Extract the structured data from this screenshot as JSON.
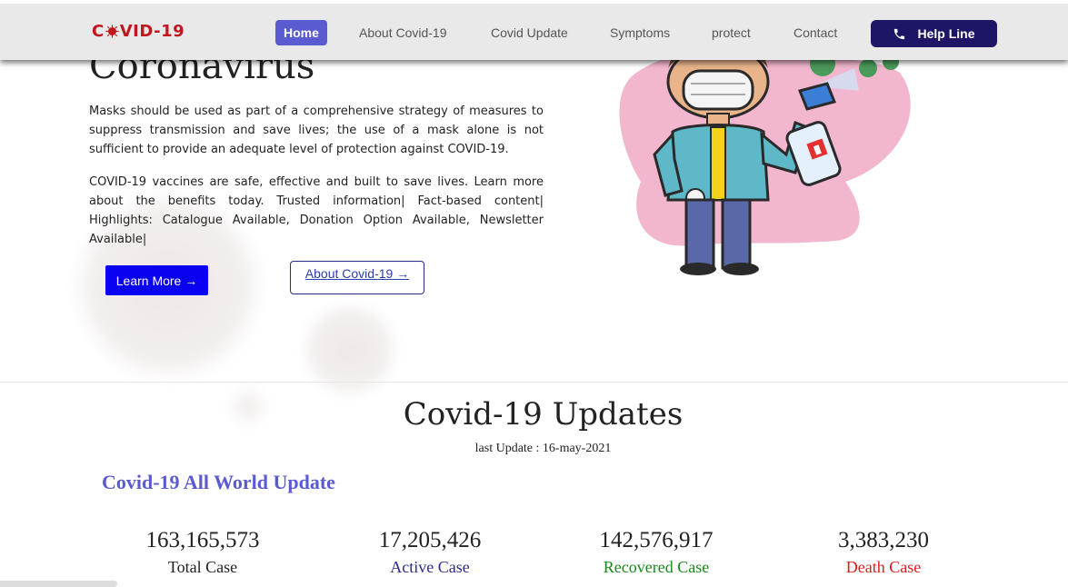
{
  "nav": {
    "logo_prefix": "C",
    "logo_suffix": "VID-19",
    "items": [
      {
        "label": "Home",
        "active": true
      },
      {
        "label": "About Covid-19"
      },
      {
        "label": "Covid Update"
      },
      {
        "label": "Symptoms"
      },
      {
        "label": "protect"
      },
      {
        "label": "Contact"
      }
    ],
    "helpline_label": "Help Line",
    "helpline_icon": "phone-icon"
  },
  "hero": {
    "title": "Coronavirus",
    "paragraph1": "Masks should be used as part of a comprehensive strategy of measures to suppress transmission and save lives; the use of a mask alone is not sufficient to provide an adequate level of protection against COVID-19.",
    "paragraph2": "COVID-19 vaccines are safe, effective and built to save lives. Learn more about the benefits today. Trusted information| Fact-based content| Highlights: Catalogue Available, Donation Option Available, Newsletter Available|",
    "learn_more": "Learn More →",
    "about_covid": "About Covid-19 →"
  },
  "updates": {
    "title": "Covid-19 Updates",
    "last_update": "last Update : 16-may-2021",
    "world_title": "Covid-19 All World Update",
    "stats": [
      {
        "value": "163,165,573",
        "label": "Total Case",
        "color": "#222222"
      },
      {
        "value": "17,205,426",
        "label": "Active Case",
        "color": "#2b2b8c"
      },
      {
        "value": "142,576,917",
        "label": "Recovered Case",
        "color": "#158a15"
      },
      {
        "value": "3,383,230",
        "label": "Death Case",
        "color": "#e01b1b"
      }
    ]
  },
  "colors": {
    "accent": "#5b5bd1",
    "helpline_bg": "#1d1666",
    "learn_btn": "#0a00f2",
    "logo_red": "#c0161d"
  }
}
